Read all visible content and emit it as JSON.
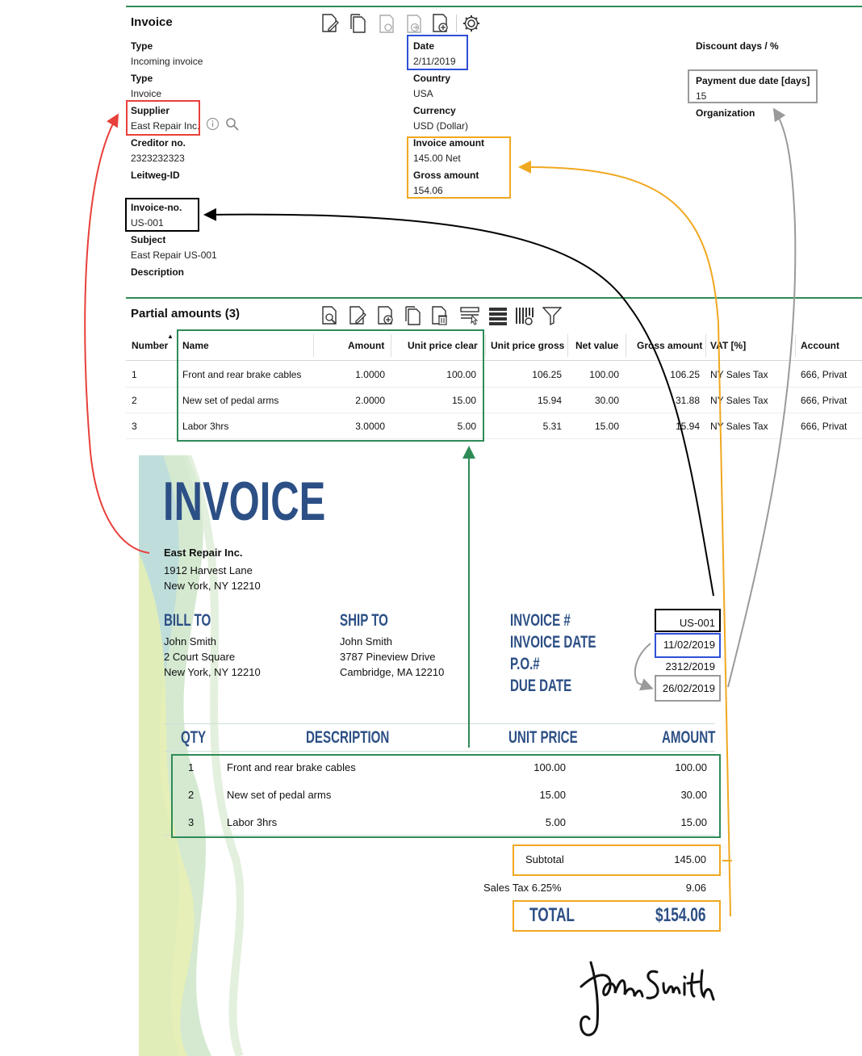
{
  "invoice_form": {
    "title": "Invoice",
    "fields_left": [
      {
        "label": "Type",
        "value": "Incoming invoice"
      },
      {
        "label": "Type",
        "value": "Invoice"
      },
      {
        "label": "Supplier",
        "value": "East Repair Inc."
      },
      {
        "label": "Creditor no.",
        "value": "2323232323"
      },
      {
        "label": "Leitweg-ID",
        "value": ""
      },
      {
        "label": "Invoice-no.",
        "value": "US-001"
      },
      {
        "label": "Subject",
        "value": "East Repair US-001"
      },
      {
        "label": "Description",
        "value": ""
      }
    ],
    "fields_mid": [
      {
        "label": "Date",
        "value": "2/11/2019"
      },
      {
        "label": "Country",
        "value": "USA"
      },
      {
        "label": "Currency",
        "value": "USD (Dollar)"
      },
      {
        "label": "Invoice amount",
        "value": "145.00 Net"
      },
      {
        "label": "Gross amount",
        "value": "154.06"
      }
    ],
    "fields_right": [
      {
        "label": "Discount days / %",
        "value": ""
      },
      {
        "label": "Payment due date [days]",
        "value": "15"
      },
      {
        "label": "Organization",
        "value": ""
      }
    ],
    "toolbar_icons": [
      "edit-document-icon",
      "copy-document-icon",
      "paste-document-icon",
      "forward-document-icon",
      "add-document-icon",
      "gear-icon"
    ]
  },
  "partial_amounts": {
    "title": "Partial amounts (3)",
    "toolbar_icons": [
      "view-document-icon",
      "edit-document-icon",
      "add-document-icon",
      "copy-document-icon",
      "delete-document-icon",
      "column-select-icon",
      "rows-icon",
      "column-settings-icon",
      "filter-icon"
    ],
    "columns": [
      "Number",
      "Name",
      "Amount",
      "Unit price clear",
      "Unit price gross",
      "Net value",
      "Gross amount",
      "VAT [%]",
      "Account"
    ],
    "rows": [
      [
        "1",
        "Front and rear brake cables",
        "1.0000",
        "100.00",
        "106.25",
        "100.00",
        "106.25",
        "NY Sales Tax",
        "666, Privat"
      ],
      [
        "2",
        "New set of pedal arms",
        "2.0000",
        "15.00",
        "15.94",
        "30.00",
        "31.88",
        "NY Sales Tax",
        "666, Privat"
      ],
      [
        "3",
        "Labor 3hrs",
        "3.0000",
        "5.00",
        "5.31",
        "15.00",
        "15.94",
        "NY Sales Tax",
        "666, Privat"
      ]
    ]
  },
  "paper_invoice": {
    "heading": "INVOICE",
    "company": "East Repair Inc.",
    "company_address": [
      "1912 Harvest Lane",
      "New York, NY 12210"
    ],
    "bill_to": {
      "label": "BILL TO",
      "lines": [
        "John Smith",
        "2 Court Square",
        "New York, NY 12210"
      ]
    },
    "ship_to": {
      "label": "SHIP TO",
      "lines": [
        "John Smith",
        "3787 Pineview Drive",
        "Cambridge, MA 12210"
      ]
    },
    "meta": [
      {
        "label": "INVOICE #",
        "value": "US-001"
      },
      {
        "label": "INVOICE DATE",
        "value": "11/02/2019"
      },
      {
        "label": "P.O.#",
        "value": "2312/2019"
      },
      {
        "label": "DUE DATE",
        "value": "26/02/2019"
      }
    ],
    "columns": [
      "QTY",
      "DESCRIPTION",
      "UNIT PRICE",
      "AMOUNT"
    ],
    "items": [
      [
        "1",
        "Front and rear brake cables",
        "100.00",
        "100.00"
      ],
      [
        "2",
        "New set of pedal arms",
        "15.00",
        "30.00"
      ],
      [
        "3",
        "Labor 3hrs",
        "5.00",
        "15.00"
      ]
    ],
    "subtotal": {
      "label": "Subtotal",
      "value": "145.00"
    },
    "tax": {
      "label": "Sales Tax 6.25%",
      "value": "9.06"
    },
    "total": {
      "label": "TOTAL",
      "value": "$154.06"
    },
    "signature": "John Smith"
  },
  "colors": {
    "red": "#e8403a",
    "blue": "#2f4fd8",
    "orange": "#f0a820",
    "green": "#2e8b57",
    "gray": "#9a9a9a",
    "black": "#000000",
    "invoice_blue": "#2c4f85"
  }
}
